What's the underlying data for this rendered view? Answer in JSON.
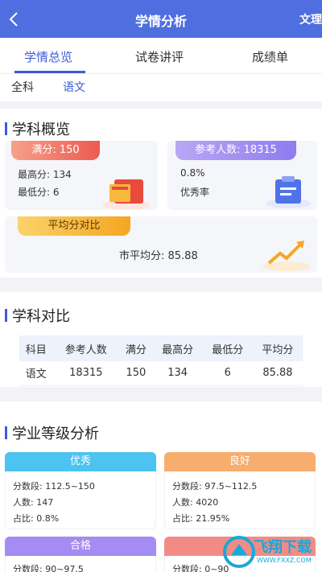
{
  "header": {
    "title": "学情分析",
    "right_label": "文理"
  },
  "tabs": [
    {
      "label": "学情总览",
      "active": true
    },
    {
      "label": "试卷讲评",
      "active": false
    },
    {
      "label": "成绩单",
      "active": false
    }
  ],
  "subjects": [
    {
      "label": "全科",
      "active": false
    },
    {
      "label": "语文",
      "active": true
    }
  ],
  "overview": {
    "title": "学科概览",
    "full_score_pill": "满分: 150",
    "max_score": "最高分: 134",
    "min_score": "最低分: 6",
    "participants_pill": "参考人数: 18315",
    "excellent_rate_value": "0.8%",
    "excellent_rate_label": "优秀率",
    "avg_pill": "平均分对比",
    "city_avg": "市平均分: 85.88"
  },
  "comparison": {
    "title": "学科对比",
    "headers": [
      "科目",
      "参考人数",
      "满分",
      "最高分",
      "最低分",
      "平均分"
    ],
    "rows": [
      [
        "语文",
        "18315",
        "150",
        "134",
        "6",
        "85.88"
      ]
    ]
  },
  "grades": {
    "title": "学业等级分析",
    "cards": [
      {
        "name": "优秀",
        "range": "分数段: 112.5~150",
        "count": "人数: 147",
        "ratio": "占比: 0.8%",
        "color": "#4cc3f0"
      },
      {
        "name": "良好",
        "range": "分数段: 97.5~112.5",
        "count": "人数: 4020",
        "ratio": "占比: 21.95%",
        "color": "#f7ad6d"
      },
      {
        "name": "合格",
        "range": "分数段: 90~97.5",
        "color": "#a58cf2"
      },
      {
        "name": "",
        "range": "分数段: 0~90",
        "color": "#f28b86"
      }
    ]
  },
  "watermark": {
    "text": "飞翔下载",
    "sub": "WWW.FXXZ.COM"
  },
  "colors": {
    "primary": "#4f6fe0",
    "accent": "#3e5bd8"
  }
}
